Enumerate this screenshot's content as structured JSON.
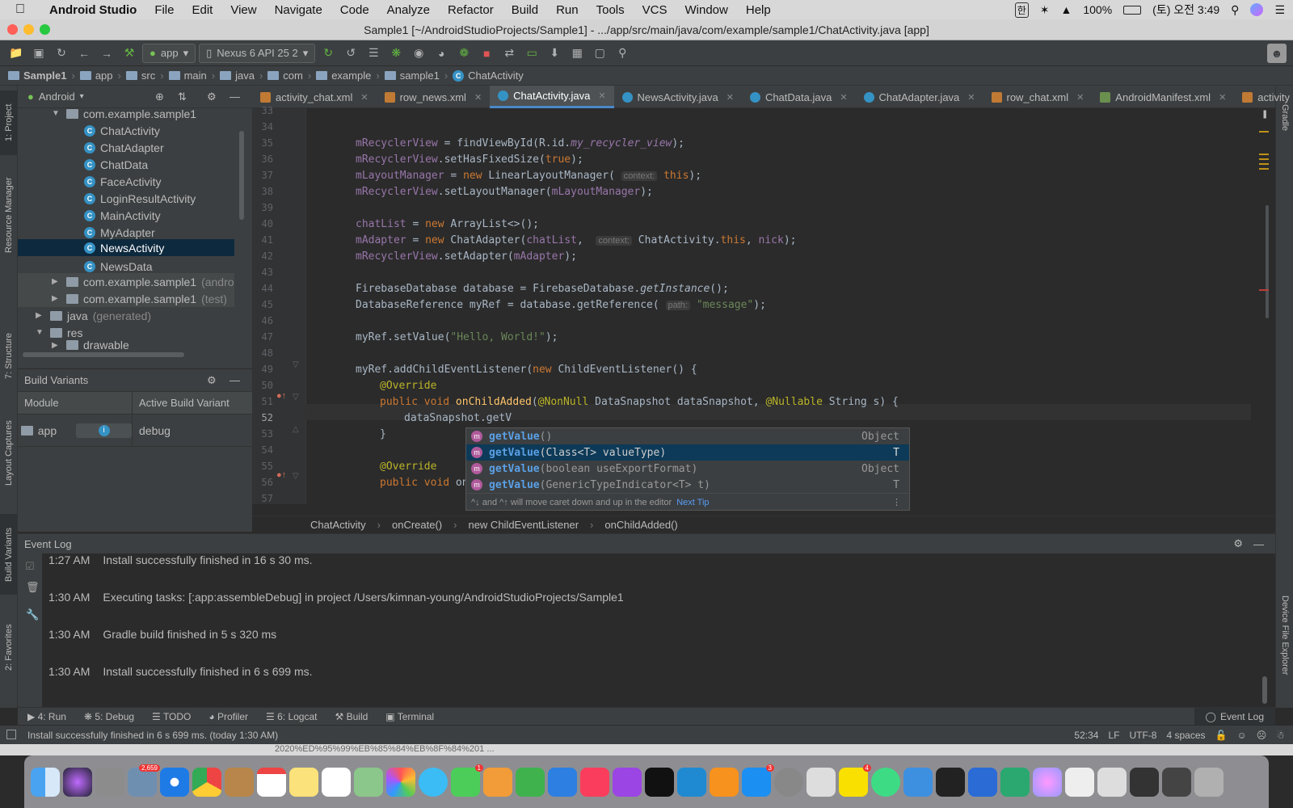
{
  "menubar": {
    "app": "Android Studio",
    "items": [
      "File",
      "Edit",
      "View",
      "Navigate",
      "Code",
      "Analyze",
      "Refactor",
      "Build",
      "Run",
      "Tools",
      "VCS",
      "Window",
      "Help"
    ],
    "battery": "100%",
    "datetime": "(토) 오전 3:49",
    "input_lang": "한"
  },
  "window": {
    "title": "Sample1 [~/AndroidStudioProjects/Sample1] - .../app/src/main/java/com/example/sample1/ChatActivity.java [app]"
  },
  "toolbar": {
    "config": "app",
    "device": "Nexus 6 API 25 2"
  },
  "navbar": {
    "crumbs": [
      "Sample1",
      "app",
      "src",
      "main",
      "java",
      "com",
      "example",
      "sample1",
      "ChatActivity"
    ]
  },
  "project": {
    "view": "Android",
    "items": [
      {
        "label": "com.example.sample1",
        "kind": "pkg",
        "open": true
      },
      {
        "label": "ChatActivity",
        "kind": "class"
      },
      {
        "label": "ChatAdapter",
        "kind": "class"
      },
      {
        "label": "ChatData",
        "kind": "class"
      },
      {
        "label": "FaceActivity",
        "kind": "class"
      },
      {
        "label": "LoginResultActivity",
        "kind": "class"
      },
      {
        "label": "MainActivity",
        "kind": "class"
      },
      {
        "label": "MyAdapter",
        "kind": "class"
      },
      {
        "label": "NewsActivity",
        "kind": "class",
        "selected": true
      },
      {
        "label": "NewsData",
        "kind": "class"
      },
      {
        "label": "com.example.sample1",
        "suffix": "(andro",
        "kind": "pkg"
      },
      {
        "label": "com.example.sample1",
        "suffix": "(test)",
        "kind": "pkg"
      },
      {
        "label": "java",
        "suffix": "(generated)",
        "kind": "folder"
      },
      {
        "label": "res",
        "kind": "folder",
        "open": true
      },
      {
        "label": "drawable",
        "kind": "folder"
      }
    ]
  },
  "build_variants": {
    "title": "Build Variants",
    "col_module": "Module",
    "col_variant": "Active Build Variant",
    "module": "app",
    "variant": "debug"
  },
  "tabs": [
    {
      "label": "activity_chat.xml",
      "kind": "xml"
    },
    {
      "label": "row_news.xml",
      "kind": "xml"
    },
    {
      "label": "ChatActivity.java",
      "kind": "class",
      "active": true
    },
    {
      "label": "NewsActivity.java",
      "kind": "class"
    },
    {
      "label": "ChatData.java",
      "kind": "class"
    },
    {
      "label": "ChatAdapter.java",
      "kind": "class"
    },
    {
      "label": "row_chat.xml",
      "kind": "xml"
    },
    {
      "label": "AndroidManifest.xml",
      "kind": "xml"
    },
    {
      "label": "activity",
      "kind": "xml"
    }
  ],
  "editor": {
    "line_numbers": [
      "33",
      "34",
      "35",
      "36",
      "37",
      "38",
      "39",
      "40",
      "41",
      "42",
      "43",
      "44",
      "45",
      "46",
      "47",
      "48",
      "49",
      "50",
      "51",
      "52",
      "53",
      "54",
      "55",
      "56",
      "57"
    ],
    "hint_context": "context:",
    "hint_path": "path:"
  },
  "completion": {
    "items": [
      {
        "bold": "getValue",
        "rest": "()",
        "type": "Object"
      },
      {
        "bold": "getValue",
        "rest": "(Class<T> valueType)",
        "type": "T",
        "selected": true
      },
      {
        "bold": "getValue",
        "rest": "(boolean useExportFormat)",
        "type": "Object"
      },
      {
        "bold": "getValue",
        "rest": "(GenericTypeIndicator<T> t)",
        "type": "T"
      }
    ],
    "tip": "^↓ and ^↑ will move caret down and up in the editor",
    "next_tip": "Next Tip"
  },
  "editor_breadcrumb": [
    "ChatActivity",
    "onCreate()",
    "new ChildEventListener",
    "onChildAdded()"
  ],
  "event_log": {
    "title": "Event Log",
    "entries": [
      {
        "time": "1:27 AM",
        "msg": "Install successfully finished in 16 s 30 ms."
      },
      {
        "time": "1:30 AM",
        "msg": "Executing tasks: [:app:assembleDebug] in project /Users/kimnan-young/AndroidStudioProjects/Sample1"
      },
      {
        "time": "1:30 AM",
        "msg": "Gradle build finished in 5 s 320 ms"
      },
      {
        "time": "1:30 AM",
        "msg": "Install successfully finished in 6 s 699 ms."
      }
    ]
  },
  "bottom_tools": [
    "4: Run",
    "5: Debug",
    "TODO",
    "Profiler",
    "6: Logcat",
    "Build",
    "Terminal"
  ],
  "event_log_button": "Event Log",
  "side_tabs": {
    "left": [
      "1: Project",
      "Resource Manager",
      "7: Structure",
      "Layout Captures",
      "Build Variants",
      "2: Favorites"
    ],
    "right": [
      "Gradle",
      "Device File Explorer"
    ]
  },
  "status": {
    "message": "Install successfully finished in 6 s 699 ms. (today 1:30 AM)",
    "position": "52:34",
    "line_sep": "LF",
    "encoding": "UTF-8",
    "indent": "4 spaces"
  },
  "finder_behind": "2020%ED%95%99%EB%85%84%EB%8F%84%201 ...",
  "dock_badges": {
    "calendar": "2,659",
    "facetime": "1",
    "appstore": "3",
    "kakao": "4"
  }
}
